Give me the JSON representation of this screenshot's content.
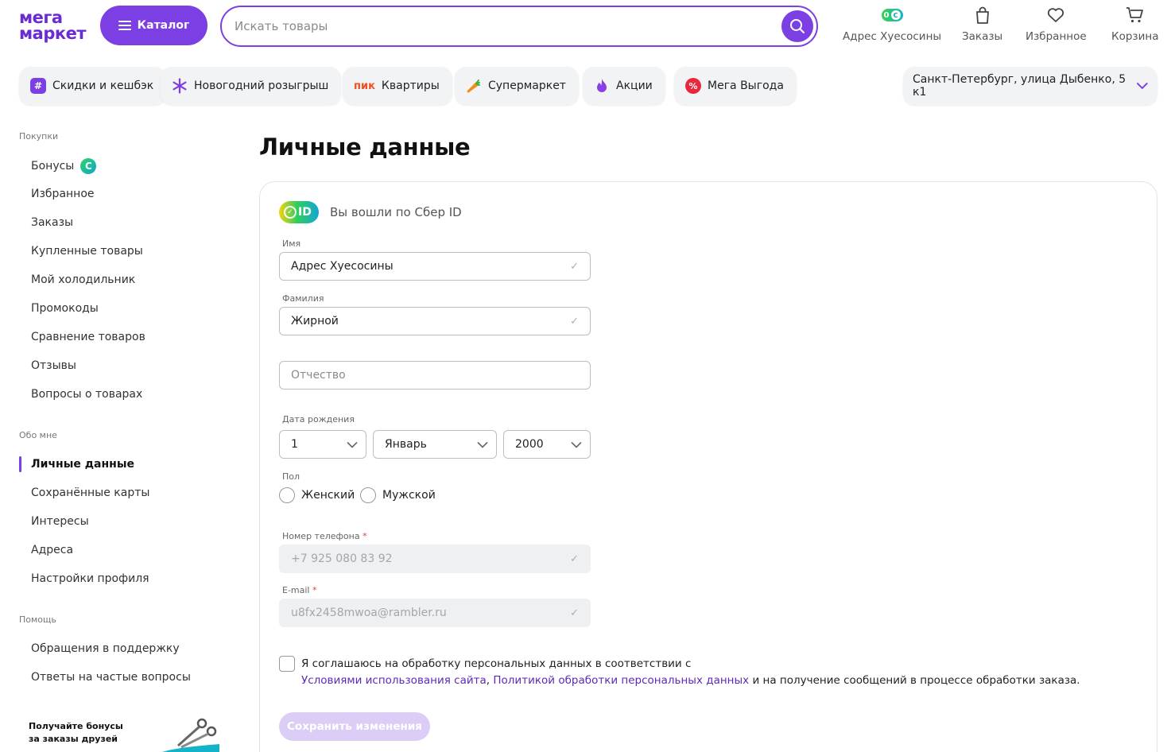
{
  "header": {
    "logo_line1": "мега",
    "logo_line2": "маркет",
    "catalog_label": "Каталог",
    "search_placeholder": "Искать товары",
    "profile_label": "Адрес Хуесосины",
    "bonus_count": "0",
    "orders_label": "Заказы",
    "favorites_label": "Избранное",
    "cart_label": "Корзина"
  },
  "chips": [
    {
      "label": "Скидки и кешбэк",
      "icon": "hashtag-icon",
      "color": "#7b3fe4"
    },
    {
      "label": "Новогодний розыгрыш",
      "icon": "snowflake-icon",
      "color": "#7b3fe4"
    },
    {
      "label": "Квартиры",
      "icon_text": "пик",
      "color": "#f04e23"
    },
    {
      "label": "Супермаркет",
      "icon": "carrot-icon",
      "color": "#f28c1e"
    },
    {
      "label": "Акции",
      "icon": "flame-icon",
      "color": "#8a3fe4"
    },
    {
      "label": "Мега Выгода",
      "icon": "percent-icon",
      "color": "#e8283c"
    }
  ],
  "delivery_address": "Санкт-Петербург, улица Дыбенко, 5 к1",
  "sidebar": {
    "sections": [
      {
        "title": "Покупки",
        "items": [
          "Бонусы",
          "Избранное",
          "Заказы",
          "Купленные товары",
          "Мой холодильник",
          "Промокоды",
          "Сравнение товаров",
          "Отзывы",
          "Вопросы о товарах"
        ]
      },
      {
        "title": "Обо мне",
        "items": [
          "Личные данные",
          "Сохранённые карты",
          "Интересы",
          "Адреса",
          "Настройки профиля"
        ]
      },
      {
        "title": "Помощь",
        "items": [
          "Обращения в поддержку",
          "Ответы на частые вопросы"
        ]
      }
    ],
    "bonus_icon_letter": "С",
    "promo_line1": "Получайте бонусы",
    "promo_line2": "за заказы друзей"
  },
  "main": {
    "title": "Личные данные",
    "sber_badge": "ID",
    "sber_text": "Вы вошли по Сбер ID",
    "first_name_label": "Имя",
    "first_name_value": "Адрес Хуесосины",
    "last_name_label": "Фамилия",
    "last_name_value": "Жирной",
    "middle_name_placeholder": "Отчество",
    "birth_label": "Дата рождения",
    "birth_day": "1",
    "birth_month": "Январь",
    "birth_year": "2000",
    "gender_label": "Пол",
    "gender_female": "Женский",
    "gender_male": "Мужской",
    "phone_label": "Номер телефона",
    "phone_value": "+7 925 080 83 92",
    "email_label": "E-mail",
    "email_value": "u8fx2458mwoa@rambler.ru",
    "required_mark": "*",
    "consent_text1": "Я соглашаюсь на обработку персональных данных в соответствии с",
    "consent_link1": "Условиями использования сайта",
    "consent_sep": ", ",
    "consent_link2": "Политикой обработки персональных данных",
    "consent_text2": " и на получение сообщений в процессе обработки заказа.",
    "save_label": "Сохранить изменения"
  },
  "colors": {
    "accent": "#7b3fe4",
    "text": "#1f1f1f",
    "disabled_bg": "#eef0f2"
  }
}
